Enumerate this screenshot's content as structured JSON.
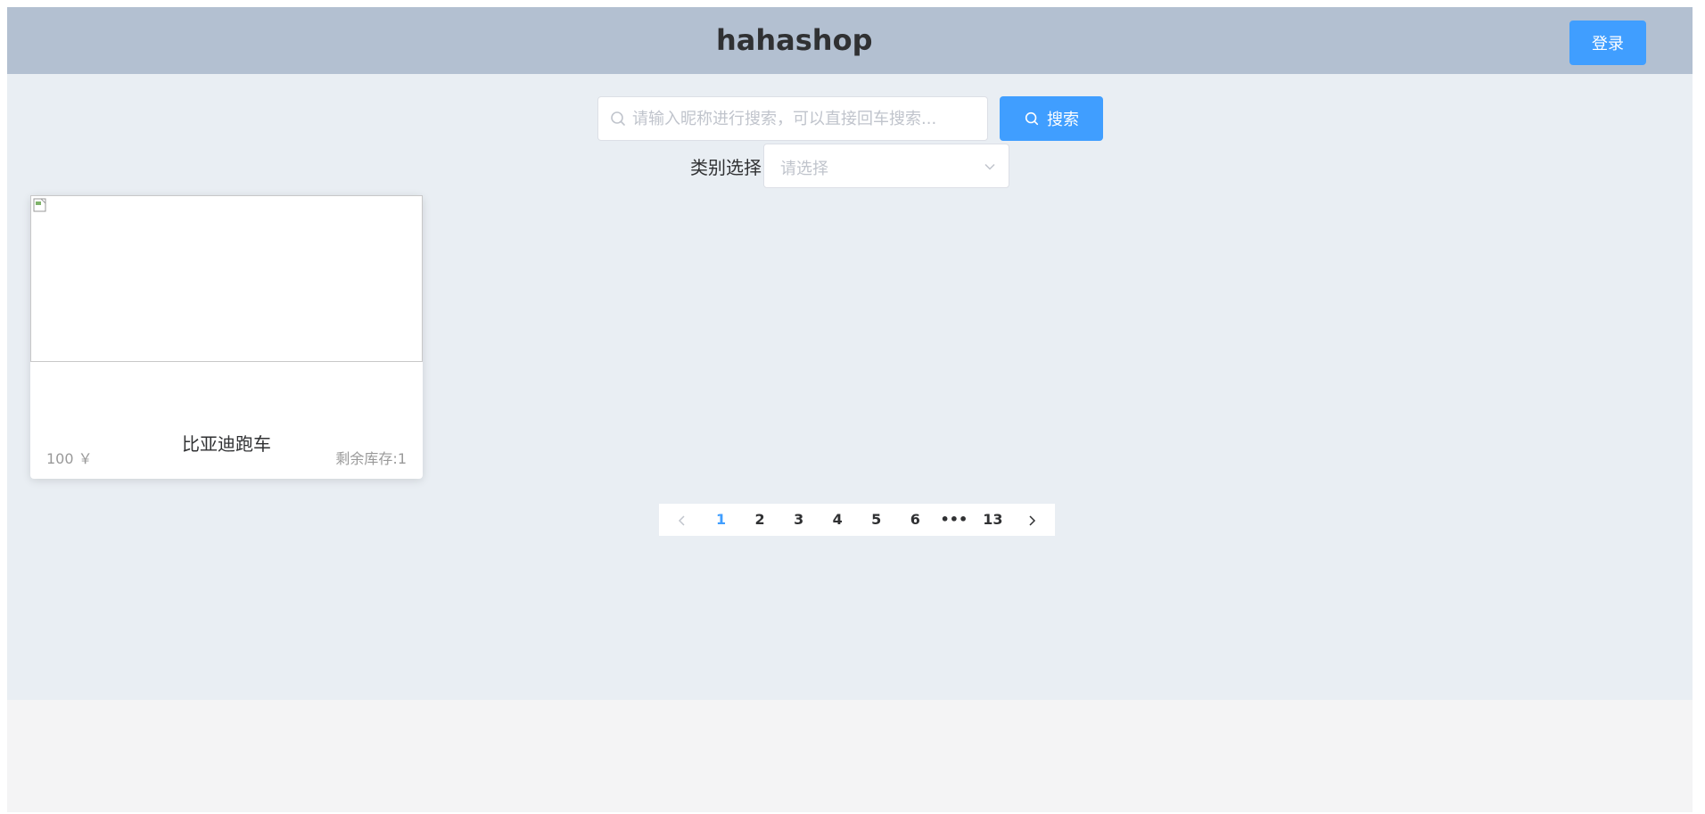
{
  "header": {
    "brand": "hahashop",
    "login_label": "登录"
  },
  "search": {
    "placeholder": "请输入昵称进行搜索，可以直接回车搜索...",
    "button_label": "搜索"
  },
  "category": {
    "label": "类别选择",
    "placeholder": "请选择"
  },
  "products": [
    {
      "name": "比亚迪跑车",
      "price": "100 ￥",
      "stock": "剩余库存:1"
    }
  ],
  "pagination": {
    "pages": [
      "1",
      "2",
      "3",
      "4",
      "5",
      "6",
      "•••",
      "13"
    ],
    "current": "1"
  },
  "colors": {
    "header_bg": "#b3c0d1",
    "main_bg": "#e9eef3",
    "accent": "#409eff"
  },
  "icons": {
    "search": "search-icon",
    "chevron": "chevron-down-icon",
    "prev": "chevron-left-icon",
    "next": "chevron-right-icon"
  }
}
